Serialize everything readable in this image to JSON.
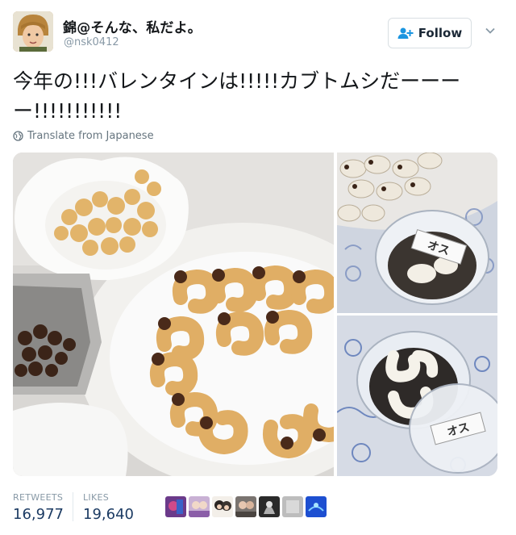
{
  "user": {
    "display_name": "錦@そんな、私だよ。",
    "handle": "@nsk0412"
  },
  "follow_button": {
    "label": "Follow"
  },
  "tweet": {
    "text": "今年の!!!バレンタインは!!!!!カブトムシだーーーー!!!!!!!!!!!",
    "translate_label": "Translate from Japanese"
  },
  "photos": {
    "sticker_label_1": "オス",
    "sticker_label_2": "オス"
  },
  "stats": {
    "retweets_label": "RETWEETS",
    "retweets_count": "16,977",
    "likes_label": "LIKES",
    "likes_count": "19,640"
  },
  "liker_avatars": [
    {
      "color": "#6b3a8a"
    },
    {
      "color": "#c9b1d4"
    },
    {
      "color": "#3c3a38"
    },
    {
      "color": "#7a7470"
    },
    {
      "color": "#2a2a2a"
    },
    {
      "color": "#bdbdbd"
    },
    {
      "color": "#1d4fd1"
    }
  ],
  "colors": {
    "accent": "#1b95e0",
    "stat_value": "#1c3b63",
    "muted": "#8899a6"
  }
}
